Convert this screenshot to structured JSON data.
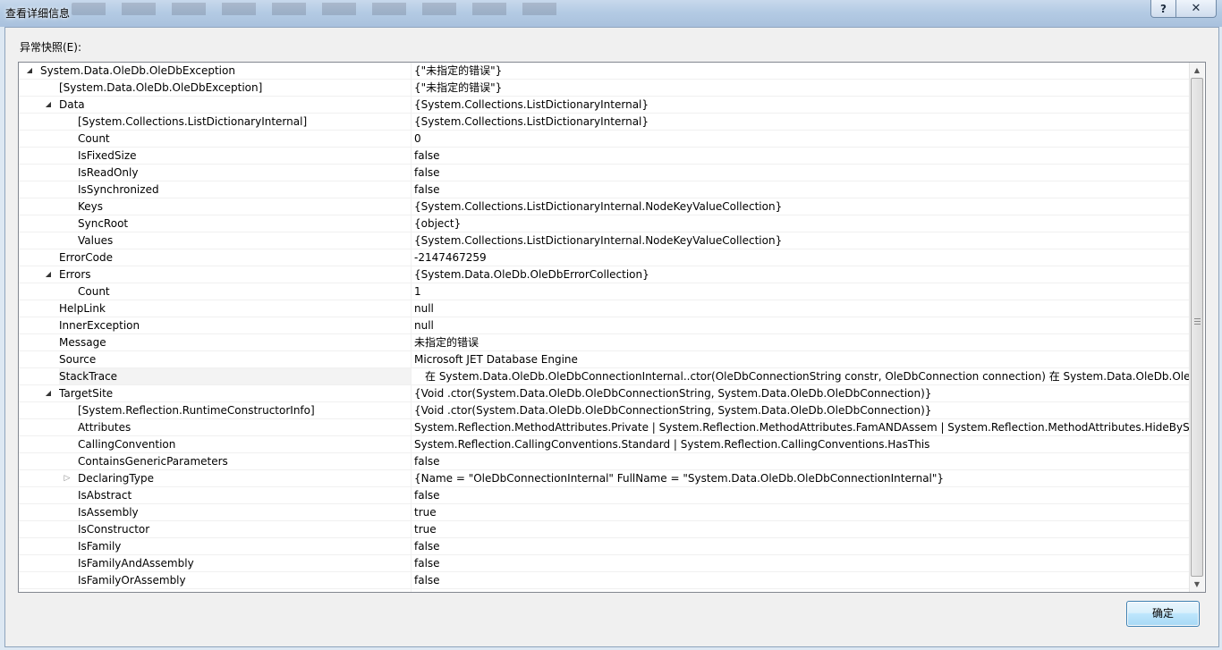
{
  "window": {
    "title": "查看详细信息",
    "help_label": "?",
    "close_label": "✕"
  },
  "snapshot_label": "异常快照(E):",
  "rows": [
    {
      "name": "System.Data.OleDb.OleDbException",
      "value": "{\"未指定的错误\"}",
      "level": 0,
      "expander": "expanded"
    },
    {
      "name": "[System.Data.OleDb.OleDbException]",
      "value": "{\"未指定的错误\"}",
      "level": 1,
      "expander": "none"
    },
    {
      "name": "Data",
      "value": "{System.Collections.ListDictionaryInternal}",
      "level": 1,
      "expander": "expanded"
    },
    {
      "name": "[System.Collections.ListDictionaryInternal]",
      "value": "{System.Collections.ListDictionaryInternal}",
      "level": 2,
      "expander": "none"
    },
    {
      "name": "Count",
      "value": "0",
      "level": 2,
      "expander": "none"
    },
    {
      "name": "IsFixedSize",
      "value": "false",
      "level": 2,
      "expander": "none"
    },
    {
      "name": "IsReadOnly",
      "value": "false",
      "level": 2,
      "expander": "none"
    },
    {
      "name": "IsSynchronized",
      "value": "false",
      "level": 2,
      "expander": "none"
    },
    {
      "name": "Keys",
      "value": "{System.Collections.ListDictionaryInternal.NodeKeyValueCollection}",
      "level": 2,
      "expander": "none"
    },
    {
      "name": "SyncRoot",
      "value": "{object}",
      "level": 2,
      "expander": "none"
    },
    {
      "name": "Values",
      "value": "{System.Collections.ListDictionaryInternal.NodeKeyValueCollection}",
      "level": 2,
      "expander": "none"
    },
    {
      "name": "ErrorCode",
      "value": "-2147467259",
      "level": 1,
      "expander": "none"
    },
    {
      "name": "Errors",
      "value": "{System.Data.OleDb.OleDbErrorCollection}",
      "level": 1,
      "expander": "expanded"
    },
    {
      "name": "Count",
      "value": "1",
      "level": 2,
      "expander": "none"
    },
    {
      "name": "HelpLink",
      "value": "null",
      "level": 1,
      "expander": "none"
    },
    {
      "name": "InnerException",
      "value": "null",
      "level": 1,
      "expander": "none"
    },
    {
      "name": "Message",
      "value": "未指定的错误",
      "level": 1,
      "expander": "none"
    },
    {
      "name": "Source",
      "value": "Microsoft JET Database Engine",
      "level": 1,
      "expander": "none"
    },
    {
      "name": "StackTrace",
      "value": "在 System.Data.OleDb.OleDbConnectionInternal..ctor(OleDbConnectionString constr, OleDbConnection connection)   在 System.Data.OleDb.OleDbC",
      "level": 1,
      "expander": "none",
      "selected": true,
      "value_indent": true
    },
    {
      "name": "TargetSite",
      "value": "{Void .ctor(System.Data.OleDb.OleDbConnectionString, System.Data.OleDb.OleDbConnection)}",
      "level": 1,
      "expander": "expanded"
    },
    {
      "name": "[System.Reflection.RuntimeConstructorInfo]",
      "value": "{Void .ctor(System.Data.OleDb.OleDbConnectionString, System.Data.OleDb.OleDbConnection)}",
      "level": 2,
      "expander": "none"
    },
    {
      "name": "Attributes",
      "value": "System.Reflection.MethodAttributes.Private | System.Reflection.MethodAttributes.FamANDAssem | System.Reflection.MethodAttributes.HideBySig | Sys",
      "level": 2,
      "expander": "none"
    },
    {
      "name": "CallingConvention",
      "value": "System.Reflection.CallingConventions.Standard | System.Reflection.CallingConventions.HasThis",
      "level": 2,
      "expander": "none"
    },
    {
      "name": "ContainsGenericParameters",
      "value": "false",
      "level": 2,
      "expander": "none"
    },
    {
      "name": "DeclaringType",
      "value": "{Name = \"OleDbConnectionInternal\" FullName = \"System.Data.OleDb.OleDbConnectionInternal\"}",
      "level": 2,
      "expander": "collapsed"
    },
    {
      "name": "IsAbstract",
      "value": "false",
      "level": 2,
      "expander": "none"
    },
    {
      "name": "IsAssembly",
      "value": "true",
      "level": 2,
      "expander": "none"
    },
    {
      "name": "IsConstructor",
      "value": "true",
      "level": 2,
      "expander": "none"
    },
    {
      "name": "IsFamily",
      "value": "false",
      "level": 2,
      "expander": "none"
    },
    {
      "name": "IsFamilyAndAssembly",
      "value": "false",
      "level": 2,
      "expander": "none"
    },
    {
      "name": "IsFamilyOrAssembly",
      "value": "false",
      "level": 2,
      "expander": "none"
    }
  ],
  "icons": {
    "expanded": "tree-expanded-icon",
    "collapsed": "tree-collapsed-icon"
  },
  "ok_button_label": "确定",
  "colors": {
    "grid_line": "#f0f0f0",
    "selected_row": "#f3f3f3",
    "button_border": "#3c7fb1"
  }
}
